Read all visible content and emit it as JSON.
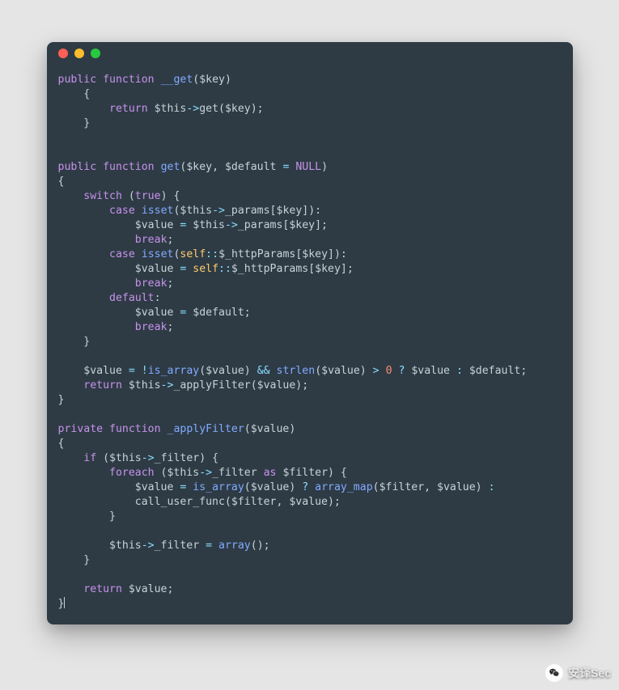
{
  "window": {
    "traffic_lights": [
      "red",
      "yellow",
      "green"
    ]
  },
  "code": {
    "tokens": [
      [
        {
          "t": "public",
          "c": "kw"
        },
        {
          "t": " "
        },
        {
          "t": "function",
          "c": "kw"
        },
        {
          "t": " "
        },
        {
          "t": "__get",
          "c": "fn"
        },
        {
          "t": "("
        },
        {
          "t": "$key"
        },
        {
          "t": ")"
        }
      ],
      [
        {
          "t": "    {"
        }
      ],
      [
        {
          "t": "        "
        },
        {
          "t": "return",
          "c": "kw"
        },
        {
          "t": " "
        },
        {
          "t": "$this"
        },
        {
          "t": "->",
          "c": "op"
        },
        {
          "t": "get($key);"
        }
      ],
      [
        {
          "t": "    }"
        }
      ],
      [],
      [],
      [
        {
          "t": "public",
          "c": "kw"
        },
        {
          "t": " "
        },
        {
          "t": "function",
          "c": "kw"
        },
        {
          "t": " "
        },
        {
          "t": "get",
          "c": "fn"
        },
        {
          "t": "($key, $default "
        },
        {
          "t": "=",
          "c": "op"
        },
        {
          "t": " "
        },
        {
          "t": "NULL",
          "c": "null"
        },
        {
          "t": ")"
        }
      ],
      [
        {
          "t": "{"
        }
      ],
      [
        {
          "t": "    "
        },
        {
          "t": "switch",
          "c": "kw"
        },
        {
          "t": " ("
        },
        {
          "t": "true",
          "c": "kw"
        },
        {
          "t": ") {"
        }
      ],
      [
        {
          "t": "        "
        },
        {
          "t": "case",
          "c": "kw"
        },
        {
          "t": " "
        },
        {
          "t": "isset",
          "c": "fn"
        },
        {
          "t": "($this"
        },
        {
          "t": "->",
          "c": "op"
        },
        {
          "t": "_params[$key]):"
        }
      ],
      [
        {
          "t": "            $value "
        },
        {
          "t": "=",
          "c": "op"
        },
        {
          "t": " $this"
        },
        {
          "t": "->",
          "c": "op"
        },
        {
          "t": "_params[$key];"
        }
      ],
      [
        {
          "t": "            "
        },
        {
          "t": "break",
          "c": "kw"
        },
        {
          "t": ";"
        }
      ],
      [
        {
          "t": "        "
        },
        {
          "t": "case",
          "c": "kw"
        },
        {
          "t": " "
        },
        {
          "t": "isset",
          "c": "fn"
        },
        {
          "t": "("
        },
        {
          "t": "self",
          "c": "self"
        },
        {
          "t": "::",
          "c": "op"
        },
        {
          "t": "$_httpParams[$key]):"
        }
      ],
      [
        {
          "t": "            $value "
        },
        {
          "t": "=",
          "c": "op"
        },
        {
          "t": " "
        },
        {
          "t": "self",
          "c": "self"
        },
        {
          "t": "::",
          "c": "op"
        },
        {
          "t": "$_httpParams[$key];"
        }
      ],
      [
        {
          "t": "            "
        },
        {
          "t": "break",
          "c": "kw"
        },
        {
          "t": ";"
        }
      ],
      [
        {
          "t": "        "
        },
        {
          "t": "default",
          "c": "kw"
        },
        {
          "t": ":"
        }
      ],
      [
        {
          "t": "            $value "
        },
        {
          "t": "=",
          "c": "op"
        },
        {
          "t": " $default;"
        }
      ],
      [
        {
          "t": "            "
        },
        {
          "t": "break",
          "c": "kw"
        },
        {
          "t": ";"
        }
      ],
      [
        {
          "t": "    }"
        }
      ],
      [],
      [
        {
          "t": "    $value "
        },
        {
          "t": "=",
          "c": "op"
        },
        {
          "t": " "
        },
        {
          "t": "!",
          "c": "op"
        },
        {
          "t": "is_array",
          "c": "fn"
        },
        {
          "t": "($value) "
        },
        {
          "t": "&&",
          "c": "op"
        },
        {
          "t": " "
        },
        {
          "t": "strlen",
          "c": "fn"
        },
        {
          "t": "($value) "
        },
        {
          "t": ">",
          "c": "op"
        },
        {
          "t": " "
        },
        {
          "t": "0",
          "c": "num"
        },
        {
          "t": " "
        },
        {
          "t": "?",
          "c": "op"
        },
        {
          "t": " $value "
        },
        {
          "t": ":",
          "c": "op"
        },
        {
          "t": " $default;"
        }
      ],
      [
        {
          "t": "    "
        },
        {
          "t": "return",
          "c": "kw"
        },
        {
          "t": " $this"
        },
        {
          "t": "->",
          "c": "op"
        },
        {
          "t": "_applyFilter($value);"
        }
      ],
      [
        {
          "t": "}"
        }
      ],
      [],
      [
        {
          "t": "private",
          "c": "kw"
        },
        {
          "t": " "
        },
        {
          "t": "function",
          "c": "kw"
        },
        {
          "t": " "
        },
        {
          "t": "_applyFilter",
          "c": "fn"
        },
        {
          "t": "($value)"
        }
      ],
      [
        {
          "t": "{"
        }
      ],
      [
        {
          "t": "    "
        },
        {
          "t": "if",
          "c": "kw"
        },
        {
          "t": " ($this"
        },
        {
          "t": "->",
          "c": "op"
        },
        {
          "t": "_filter) {"
        }
      ],
      [
        {
          "t": "        "
        },
        {
          "t": "foreach",
          "c": "kw"
        },
        {
          "t": " ($this"
        },
        {
          "t": "->",
          "c": "op"
        },
        {
          "t": "_filter "
        },
        {
          "t": "as",
          "c": "kw"
        },
        {
          "t": " $filter) {"
        }
      ],
      [
        {
          "t": "            $value "
        },
        {
          "t": "=",
          "c": "op"
        },
        {
          "t": " "
        },
        {
          "t": "is_array",
          "c": "fn"
        },
        {
          "t": "($value) "
        },
        {
          "t": "?",
          "c": "op"
        },
        {
          "t": " "
        },
        {
          "t": "array_map",
          "c": "fn"
        },
        {
          "t": "($filter, $value) "
        },
        {
          "t": ":",
          "c": "op"
        }
      ],
      [
        {
          "t": "            call_user_func($filter, $value);"
        }
      ],
      [
        {
          "t": "        }"
        }
      ],
      [],
      [
        {
          "t": "        $this"
        },
        {
          "t": "->",
          "c": "op"
        },
        {
          "t": "_filter "
        },
        {
          "t": "=",
          "c": "op"
        },
        {
          "t": " "
        },
        {
          "t": "array",
          "c": "fn"
        },
        {
          "t": "();"
        }
      ],
      [
        {
          "t": "    }"
        }
      ],
      [],
      [
        {
          "t": "    "
        },
        {
          "t": "return",
          "c": "kw"
        },
        {
          "t": " $value;"
        }
      ],
      [
        {
          "t": "}",
          "cursor": true
        }
      ]
    ]
  },
  "watermark": {
    "label": "安译Sec",
    "icon": "wechat-icon"
  }
}
